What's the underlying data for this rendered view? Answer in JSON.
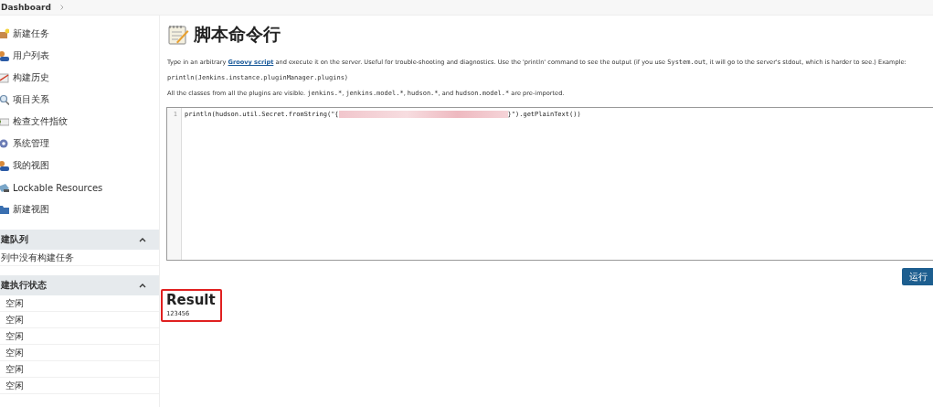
{
  "breadcrumb": {
    "label": "Dashboard"
  },
  "sidebar": {
    "items": [
      {
        "label": "新建任务"
      },
      {
        "label": "用户列表"
      },
      {
        "label": "构建历史"
      },
      {
        "label": "项目关系"
      },
      {
        "label": "检查文件指纹"
      },
      {
        "label": "系统管理"
      },
      {
        "label": "我的视图"
      },
      {
        "label": "Lockable Resources"
      },
      {
        "label": "新建视图"
      }
    ]
  },
  "build_queue": {
    "title": "建队列",
    "expanded": true,
    "empty_text": "列中没有构建任务"
  },
  "executors": {
    "title": "建执行状态",
    "expanded": true,
    "rows": [
      {
        "status": "空闲"
      },
      {
        "status": "空闲"
      },
      {
        "status": "空闲"
      },
      {
        "status": "空闲"
      },
      {
        "status": "空闲"
      },
      {
        "status": "空闲"
      }
    ]
  },
  "main": {
    "title": "脚本命令行",
    "description": [
      {
        "kind": "plain",
        "text": "Type in an arbitrary "
      },
      {
        "kind": "link",
        "text": "Groovy script"
      },
      {
        "kind": "plain",
        "text": " and execute it on the server. Useful for trouble-shooting and diagnostics. Use the 'println' command to see the output (if you use "
      },
      {
        "kind": "code",
        "text": "System.out"
      },
      {
        "kind": "plain",
        "text": ", it will go to the server's stdout, which is harder to see.) Example:"
      }
    ],
    "example": "println(Jenkins.instance.pluginManager.plugins)",
    "imports_note": [
      {
        "kind": "plain",
        "text": "All the classes from all the plugins are visible. "
      },
      {
        "kind": "code",
        "text": "jenkins.*"
      },
      {
        "kind": "plain",
        "text": ", "
      },
      {
        "kind": "code",
        "text": "jenkins.model.*"
      },
      {
        "kind": "plain",
        "text": ", "
      },
      {
        "kind": "code",
        "text": "hudson.*"
      },
      {
        "kind": "plain",
        "text": ", and "
      },
      {
        "kind": "code",
        "text": "hudson.model.*"
      },
      {
        "kind": "plain",
        "text": " are pre-imported."
      }
    ],
    "editor": {
      "line_number": "1",
      "code_before": "println(hudson.util.Secret.fromString(\"{",
      "redacted": true,
      "code_after": "}\").getPlainText())"
    },
    "run_button": "运行",
    "result": {
      "title": "Result",
      "output": "123456"
    }
  }
}
